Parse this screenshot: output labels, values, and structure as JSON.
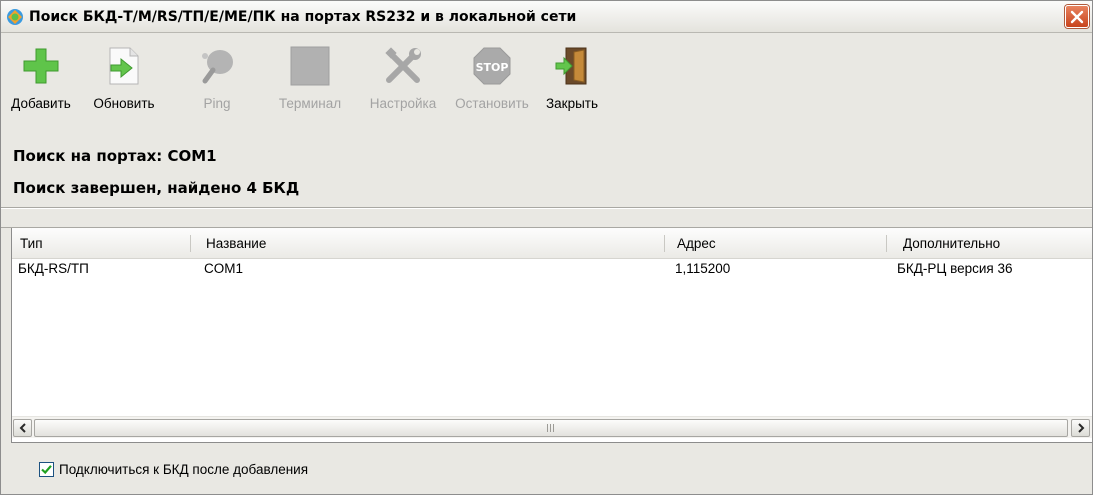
{
  "window": {
    "title": "Поиск БКД-Т/М/RS/ТП/Е/МЕ/ПК на портах RS232 и в локальной сети",
    "close_icon": "close-x-icon"
  },
  "toolbar": {
    "buttons": [
      {
        "label": "Добавить",
        "icon": "plus-icon",
        "enabled": true
      },
      {
        "label": "Обновить",
        "icon": "refresh-arrow-icon",
        "enabled": true
      },
      {
        "label": "Ping",
        "icon": "ping-icon",
        "enabled": false
      },
      {
        "label": "Терминал",
        "icon": "terminal-icon",
        "enabled": false
      },
      {
        "label": "Настройка",
        "icon": "wrench-screwdriver-icon",
        "enabled": false
      },
      {
        "label": "Остановить",
        "icon": "stop-sign-icon",
        "enabled": false
      },
      {
        "label": "Закрыть",
        "icon": "exit-door-icon",
        "enabled": true
      }
    ]
  },
  "status": {
    "line1": "Поиск на портах: COM1",
    "line2": "Поиск завершен, найдено 4 БКД"
  },
  "table": {
    "columns": [
      "Тип",
      "Название",
      "Адрес",
      "Дополнительно"
    ],
    "rows": [
      [
        "БКД-RS/ТП",
        "COM1",
        "1,115200",
        "БКД-РЦ версия 36"
      ]
    ]
  },
  "options": {
    "connect_after_add_label": "Подключиться к БКД после добавления",
    "connect_after_add_checked": true
  },
  "colors": {
    "window_bg": "#e9e8e3",
    "close_button": "#c8431c",
    "checkbox_check": "#21a121",
    "disabled_text": "#a3a3a3"
  }
}
